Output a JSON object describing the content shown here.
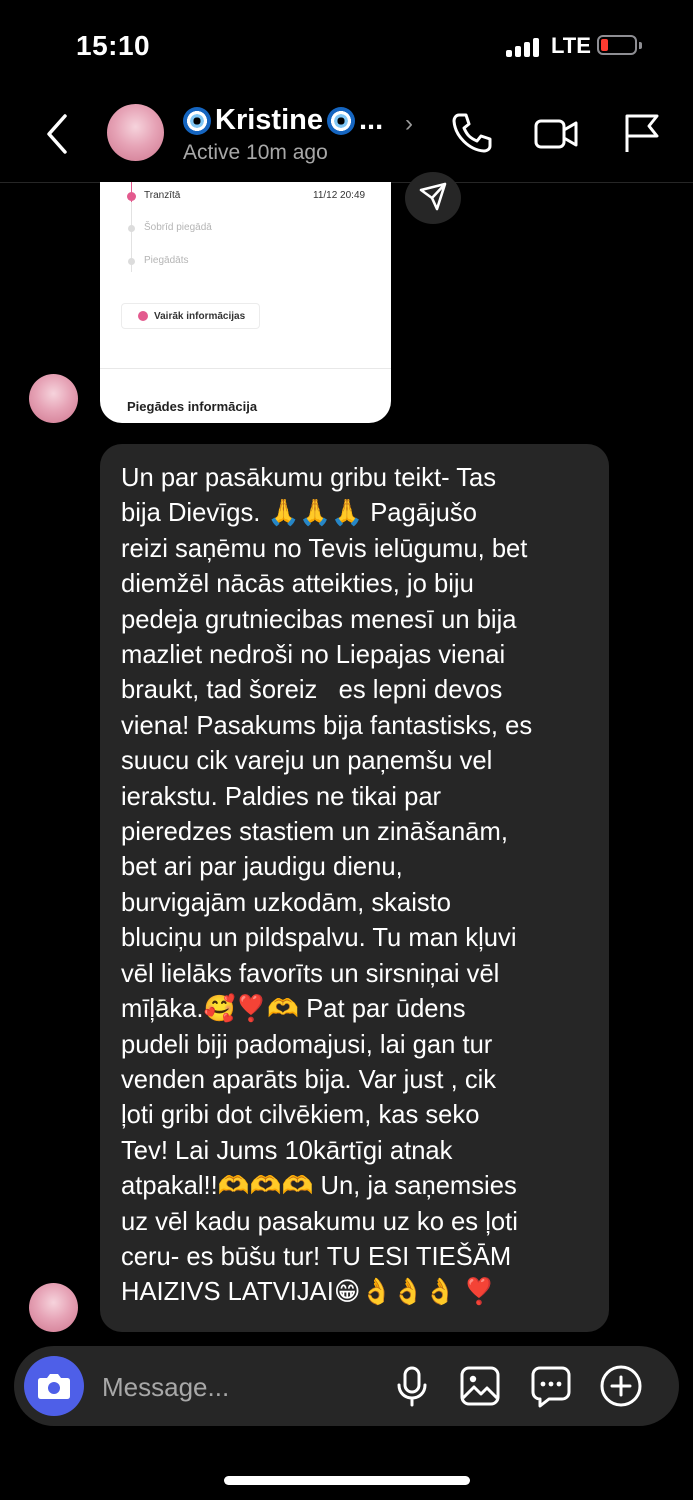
{
  "status_bar": {
    "time": "15:10",
    "network": "LTE"
  },
  "header": {
    "name": "Kristine",
    "name_truncation": "...",
    "status": "Active 10m ago",
    "icons": [
      "back-icon",
      "phone-icon",
      "video-call-icon",
      "flag-icon"
    ]
  },
  "shared_card": {
    "steps": [
      {
        "label": "Tranzītā",
        "date": "11/12 20:49",
        "state": "active"
      },
      {
        "label": "Šobrīd piegādā",
        "state": "pending"
      },
      {
        "label": "Piegādāts",
        "state": "pending"
      }
    ],
    "more_button": "Vairāk informācijas",
    "footer_title": "Piegādes informācija"
  },
  "message": {
    "lines": [
      "Un par pasākumu gribu teikt- Tas",
      "bija Dievīgs. 🙏🙏🙏 Pagājušo",
      "reizi saņēmu no Tevis ielūgumu, bet",
      "diemžēl nācās atteikties, jo biju",
      "pedeja grutniecibas menesī un bija",
      "mazliet nedroši no Liepajas vienai",
      "braukt, tad šoreiz   es lepni devos",
      "viena! Pasakums bija fantastisks, es",
      "suucu cik vareju un paņemšu vel",
      "ierakstu. Paldies ne tikai par",
      "pieredzes stastiem un zināšanām,",
      "bet ari par jaudigu dienu,",
      "burvigajām uzkodām, skaisto",
      "bluciņu un pildspalvu. Tu man kļuvi",
      "vēl lielāks favorīts un sirsniņai vēl",
      "mīļāka.🥰❣️🫶 Pat par ūdens",
      "pudeli biji padomajusi, lai gan tur",
      "venden aparāts bija. Var just , cik",
      "ļoti gribi dot cilvēkiem, kas seko",
      "Tev! Lai Jums 10kārtīgi atnak",
      "atpakal!!🫶🫶🫶 Un, ja saņemsies",
      "uz vēl kadu pasakumu uz ko es ļoti",
      "ceru- es būšu tur! TU ESI TIEŠĀM",
      "HAIZIVS LATVIJAI😁👌👌👌 ❣️"
    ]
  },
  "composer": {
    "placeholder": "Message...",
    "icons": [
      "camera-icon",
      "microphone-icon",
      "gallery-icon",
      "sticker-icon",
      "add-icon"
    ]
  }
}
